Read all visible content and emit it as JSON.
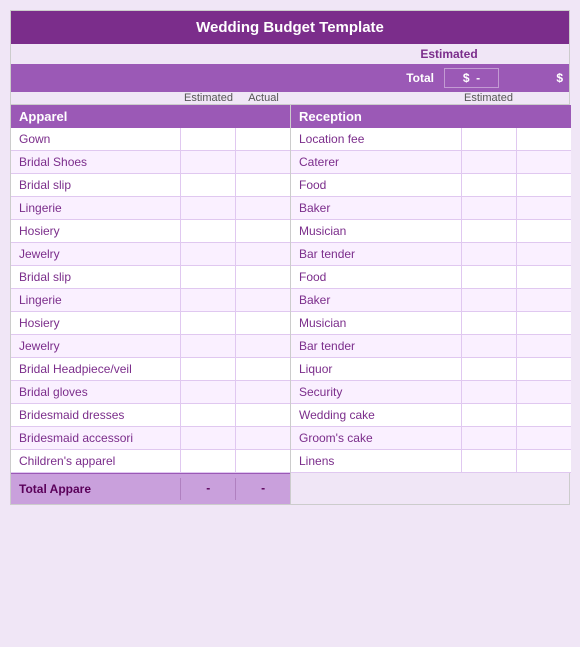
{
  "title": "Wedding Budget Template",
  "estimated_header": "Estimated",
  "total_label": "Total",
  "total_dollar_sign": "$",
  "total_dash": "-",
  "dollar_sign_right": "$",
  "columns": {
    "estimated": "Estimated",
    "actual": "Actual",
    "estimated_right": "Estimated"
  },
  "left_section": {
    "header": "Apparel",
    "items": [
      "Gown",
      "Bridal Shoes",
      "Bridal slip",
      "Lingerie",
      "Hosiery",
      "Jewelry",
      "Bridal slip",
      "Lingerie",
      "Hosiery",
      "Jewelry",
      "Bridal Headpiece/veil",
      "Bridal gloves",
      "Bridesmaid dresses",
      "Bridesmaid accessori",
      "Children's apparel"
    ],
    "total_label": "Total Appare",
    "total_estimated": "-",
    "total_actual": "-"
  },
  "right_section": {
    "header": "Reception",
    "items": [
      "Location fee",
      "Caterer",
      "Food",
      "Baker",
      "Musician",
      "Bar tender",
      "Food",
      "Baker",
      "Musician",
      "Bar tender",
      "Liquor",
      "Security",
      "Wedding cake",
      "Groom's cake",
      "Linens"
    ]
  }
}
